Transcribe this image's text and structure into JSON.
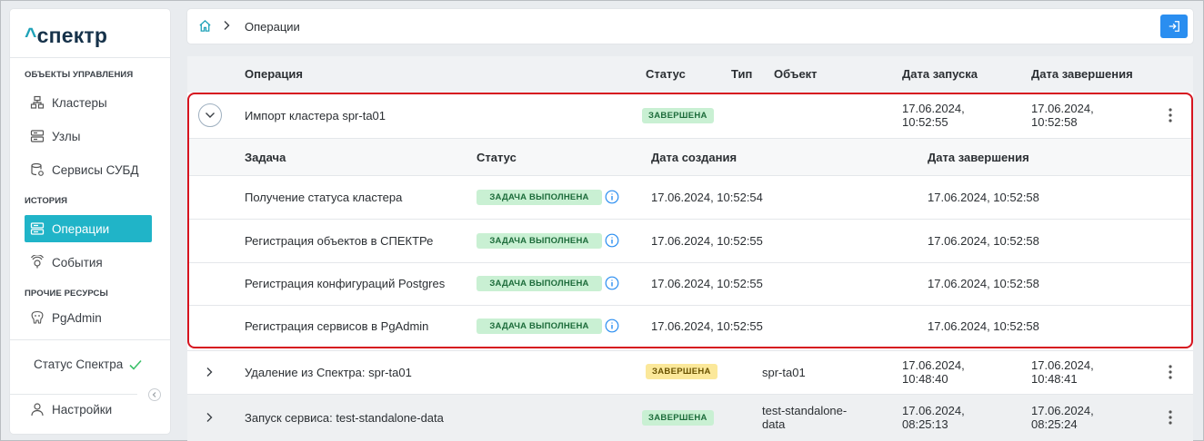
{
  "app": {
    "logo_caret": "^",
    "logo_text": "спектр"
  },
  "sidebar": {
    "sections": [
      {
        "label": "ОБЪЕКТЫ УПРАВЛЕНИЯ"
      },
      {
        "label": "ИСТОРИЯ"
      },
      {
        "label": "ПРОЧИЕ РЕСУРСЫ"
      }
    ],
    "items": [
      {
        "label": "Кластеры",
        "icon": "cluster-icon"
      },
      {
        "label": "Узлы",
        "icon": "server-icon"
      },
      {
        "label": "Сервисы СУБД",
        "icon": "database-gear-icon"
      },
      {
        "label": "Операции",
        "icon": "operations-icon",
        "active": true
      },
      {
        "label": "События",
        "icon": "events-icon"
      },
      {
        "label": "PgAdmin",
        "icon": "pgadmin-icon"
      }
    ],
    "status_label": "Статус Спектра",
    "settings_label": "Настройки"
  },
  "header": {
    "breadcrumb": "Операции"
  },
  "table": {
    "columns": {
      "operation": "Операция",
      "status": "Статус",
      "type": "Тип",
      "object": "Объект",
      "start": "Дата запуска",
      "end": "Дата завершения"
    },
    "rows": [
      {
        "operation": "Импорт кластера spr-ta01",
        "status": "ЗАВЕРШЕНА",
        "status_color": "#c9f0d3",
        "object": "",
        "start_date": "17.06.2024,",
        "start_time": "10:52:55",
        "end_date": "17.06.2024,",
        "end_time": "10:52:58",
        "expanded": true
      },
      {
        "operation": "Удаление из Спектра: spr-ta01",
        "status": "ЗАВЕРШЕНА",
        "status_color": "#fbe89a",
        "object": "spr-ta01",
        "start_date": "17.06.2024,",
        "start_time": "10:48:40",
        "end_date": "17.06.2024,",
        "end_time": "10:48:41"
      },
      {
        "operation": "Запуск сервиса: test-standalone-data",
        "status": "ЗАВЕРШЕНА",
        "status_color": "#c9f0d3",
        "object_line1": "test-standalone-",
        "object_line2": "data",
        "start_date": "17.06.2024,",
        "start_time": "08:25:13",
        "end_date": "17.06.2024,",
        "end_time": "08:25:24"
      }
    ],
    "subtable": {
      "columns": {
        "task": "Задача",
        "status": "Статус",
        "created": "Дата создания",
        "finished": "Дата завершения"
      },
      "rows": [
        {
          "task": "Получение статуса кластера",
          "status": "ЗАДАЧА ВЫПОЛНЕНА",
          "created": "17.06.2024, 10:52:54",
          "finished": "17.06.2024, 10:52:58"
        },
        {
          "task": "Регистрация объектов в СПЕКТРе",
          "status": "ЗАДАЧА ВЫПОЛНЕНА",
          "created": "17.06.2024, 10:52:55",
          "finished": "17.06.2024, 10:52:58"
        },
        {
          "task": "Регистрация конфигураций Postgres",
          "status": "ЗАДАЧА ВЫПОЛНЕНА",
          "created": "17.06.2024, 10:52:55",
          "finished": "17.06.2024, 10:52:58"
        },
        {
          "task": "Регистрация сервисов в PgAdmin",
          "status": "ЗАДАЧА ВЫПОЛНЕНА",
          "created": "17.06.2024, 10:52:55",
          "finished": "17.06.2024, 10:52:58"
        }
      ]
    }
  },
  "colors": {
    "accent": "#20b4c8",
    "primary_button": "#2a8ef0",
    "highlight_border": "#d6141f"
  }
}
